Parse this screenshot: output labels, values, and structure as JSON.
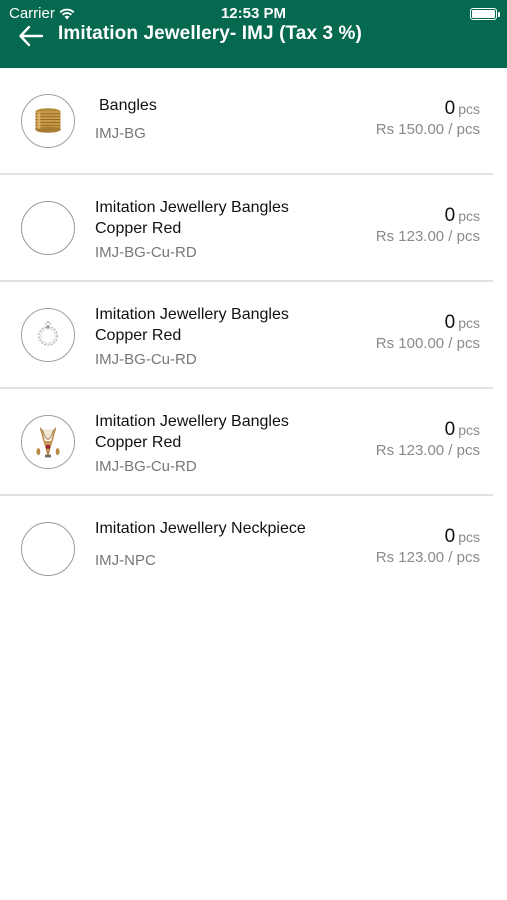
{
  "status_bar": {
    "carrier": "Carrier",
    "time": "12:53 PM"
  },
  "header": {
    "title": "Imitation Jewellery- IMJ (Tax 3 %)"
  },
  "colors": {
    "header_bg": "#05694f",
    "divider": "#e2e2e2"
  },
  "products": [
    {
      "name": "Bangles",
      "code": "IMJ-BG",
      "qty": "0",
      "unit": "pcs",
      "price": "Rs 150.00 / pcs",
      "image": "gold-bangles-stack"
    },
    {
      "name": "Imitation Jewellery Bangles Copper  Red",
      "code": "IMJ-BG-Cu-RD",
      "qty": "0",
      "unit": "pcs",
      "price": "Rs 123.00 / pcs",
      "image": "empty"
    },
    {
      "name": "Imitation Jewellery Bangles Copper  Red",
      "code": "IMJ-BG-Cu-RD",
      "qty": "0",
      "unit": "pcs",
      "price": "Rs 100.00 / pcs",
      "image": "silver-bracelet"
    },
    {
      "name": "Imitation Jewellery Bangles Copper  Red",
      "code": "IMJ-BG-Cu-RD",
      "qty": "0",
      "unit": "pcs",
      "price": "Rs 123.00 / pcs",
      "image": "necklace-set"
    },
    {
      "name": "Imitation Jewellery Neckpiece",
      "code": "IMJ-NPC",
      "qty": "0",
      "unit": "pcs",
      "price": "Rs 123.00 / pcs",
      "image": "empty"
    }
  ]
}
